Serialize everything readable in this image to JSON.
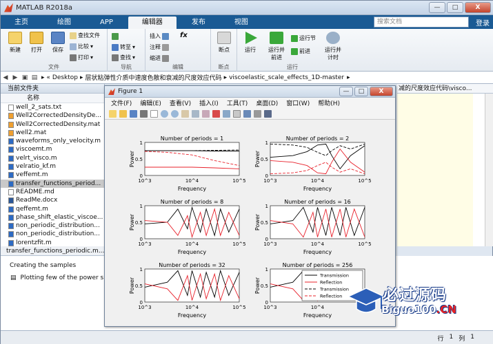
{
  "app": {
    "title": "MATLAB R2018a"
  },
  "window_buttons": {
    "minimize": "—",
    "maximize": "□",
    "close": "X"
  },
  "ribbon_tabs": [
    "主页",
    "绘图",
    "APP",
    "编辑器",
    "发布",
    "视图"
  ],
  "active_tab_index": 3,
  "search": {
    "placeholder": "搜索文档"
  },
  "login_label": "登录",
  "toolstrip": {
    "file_group": {
      "label": "文件",
      "new": "新建",
      "open": "打开",
      "save": "保存",
      "find_files": "查找文件",
      "compare": "比较",
      "print": "打印"
    },
    "nav_group": {
      "label": "导航",
      "goto": "转至",
      "find": "查找"
    },
    "edit_group": {
      "label": "编辑",
      "insert": "插入",
      "comment": "注释",
      "indent": "缩进",
      "fx": "fx"
    },
    "bp_group": {
      "label": "断点",
      "breakpoints": "断点"
    },
    "run_group": {
      "label": "运行",
      "run": "运行",
      "run_advance": "运行并\n前进",
      "run_section": "运行节",
      "advance": "前进",
      "run_time": "运行并\n计时"
    }
  },
  "address": {
    "segments": [
      "Desktop",
      "层状粘弹性介质中速度色散和衰减的尺度效应代码",
      "viscoelastic_scale_effects_1D-master"
    ],
    "editor_tail": "减的尺度效应代码\\visco..."
  },
  "current_folder": {
    "title": "当前文件夹",
    "column": "名称",
    "files": [
      {
        "name": "well_2_sats.txt",
        "type": "txt"
      },
      {
        "name": "Well2CorrectedDensityDe...",
        "type": "mat"
      },
      {
        "name": "Well2CorrectedDensity.mat",
        "type": "mat"
      },
      {
        "name": "well2.mat",
        "type": "mat"
      },
      {
        "name": "waveforms_only_velocity.m",
        "type": "m"
      },
      {
        "name": "viscoemt.m",
        "type": "m"
      },
      {
        "name": "velrt_visco.m",
        "type": "m"
      },
      {
        "name": "velratio_kf.m",
        "type": "m"
      },
      {
        "name": "veffemt.m",
        "type": "m"
      },
      {
        "name": "transfer_functions_period...",
        "type": "m",
        "selected": true
      },
      {
        "name": "README.md",
        "type": "txt"
      },
      {
        "name": "ReadMe.docx",
        "type": "doc"
      },
      {
        "name": "qeffemt.m",
        "type": "m"
      },
      {
        "name": "phase_shift_elastic_viscoe...",
        "type": "m"
      },
      {
        "name": "non_periodic_distribution...",
        "type": "m"
      },
      {
        "name": "non_periodic_distribution...",
        "type": "m"
      },
      {
        "name": "lorentzfit.m",
        "type": "m"
      }
    ]
  },
  "details": {
    "filename": "transfer_functions_periodic.m..."
  },
  "outline": {
    "section1": "Creating the samples",
    "section2": "Plotting few of the power sp"
  },
  "status": {
    "row_label": "行",
    "row": "1",
    "col_label": "列",
    "col": "1"
  },
  "figure": {
    "title": "Figure 1",
    "menu": [
      "文件(F)",
      "编辑(E)",
      "查看(V)",
      "插入(I)",
      "工具(T)",
      "桌面(D)",
      "窗口(W)",
      "帮助(H)"
    ]
  },
  "colors": {
    "tabbar": "#1a5a94",
    "series_black": "#000000",
    "series_red": "#e8202a"
  },
  "chart_data": [
    {
      "type": "line",
      "title": "Number of periods = 1",
      "xlabel": "Frequency",
      "ylabel": "Power",
      "xscale": "log",
      "xlim": [
        1000,
        100000
      ],
      "ylim": [
        0,
        1
      ],
      "yticks": [
        0,
        0.5,
        1
      ],
      "xticks": [
        "10^3",
        "10^4",
        "10^5"
      ],
      "series": [
        {
          "color": "black",
          "dash": false,
          "x": [
            1000,
            3000,
            10000,
            30000,
            100000
          ],
          "y": [
            0.75,
            0.75,
            0.75,
            0.74,
            0.74
          ]
        },
        {
          "color": "red",
          "dash": false,
          "x": [
            1000,
            3000,
            10000,
            30000,
            100000
          ],
          "y": [
            0.25,
            0.25,
            0.25,
            0.23,
            0.2
          ]
        },
        {
          "color": "black",
          "dash": true,
          "x": [
            1000,
            3000,
            10000,
            30000,
            100000
          ],
          "y": [
            0.75,
            0.75,
            0.75,
            0.76,
            0.77
          ]
        },
        {
          "color": "red",
          "dash": true,
          "x": [
            1000,
            3000,
            10000,
            30000,
            100000
          ],
          "y": [
            0.73,
            0.7,
            0.62,
            0.45,
            0.3
          ]
        }
      ]
    },
    {
      "type": "line",
      "title": "Number of periods = 2",
      "xlabel": "Frequency",
      "ylabel": "Power",
      "xscale": "log",
      "xlim": [
        1000,
        100000
      ],
      "ylim": [
        0,
        1
      ],
      "yticks": [
        0,
        0.5,
        1
      ],
      "xticks": [
        "10^3",
        "10^4",
        "10^5"
      ],
      "series": [
        {
          "color": "black",
          "dash": false,
          "x": [
            1000,
            3000,
            6000,
            10000,
            15000,
            20000,
            30000,
            50000,
            100000
          ],
          "y": [
            0.55,
            0.6,
            0.72,
            0.92,
            0.95,
            0.6,
            0.2,
            0.6,
            0.9
          ]
        },
        {
          "color": "red",
          "dash": false,
          "x": [
            1000,
            3000,
            6000,
            10000,
            15000,
            20000,
            30000,
            50000,
            100000
          ],
          "y": [
            0.45,
            0.4,
            0.3,
            0.08,
            0.05,
            0.4,
            0.8,
            0.4,
            0.1
          ]
        },
        {
          "color": "black",
          "dash": true,
          "x": [
            1000,
            3000,
            6000,
            10000,
            15000,
            20000,
            30000,
            50000,
            100000
          ],
          "y": [
            0.95,
            0.92,
            0.85,
            0.7,
            0.6,
            0.75,
            0.9,
            0.8,
            0.95
          ]
        },
        {
          "color": "red",
          "dash": true,
          "x": [
            1000,
            3000,
            6000,
            10000,
            15000,
            20000,
            30000,
            50000,
            100000
          ],
          "y": [
            0.05,
            0.08,
            0.15,
            0.3,
            0.4,
            0.25,
            0.1,
            0.2,
            0.05
          ]
        }
      ]
    },
    {
      "type": "line",
      "title": "Number of periods = 8",
      "xlabel": "Frequency",
      "ylabel": "Power",
      "xscale": "log",
      "xlim": [
        1000,
        100000
      ],
      "ylim": [
        0,
        1
      ],
      "yticks": [
        0,
        0.5,
        1
      ],
      "xticks": [
        "10^3",
        "10^4",
        "10^5"
      ],
      "series": [
        {
          "color": "black",
          "dash": false,
          "x": [
            1000,
            3000,
            5000,
            8000,
            10000,
            15000,
            20000,
            30000,
            40000,
            60000,
            100000
          ],
          "y": [
            0.45,
            0.5,
            0.9,
            0.3,
            0.95,
            0.2,
            0.9,
            0.1,
            0.9,
            0.2,
            0.9
          ]
        },
        {
          "color": "red",
          "dash": false,
          "x": [
            1000,
            3000,
            5000,
            8000,
            10000,
            15000,
            20000,
            30000,
            40000,
            60000,
            100000
          ],
          "y": [
            0.55,
            0.5,
            0.1,
            0.7,
            0.05,
            0.8,
            0.1,
            0.9,
            0.1,
            0.8,
            0.1
          ]
        }
      ]
    },
    {
      "type": "line",
      "title": "Number of periods = 16",
      "xlabel": "Frequency",
      "ylabel": "Power",
      "xscale": "log",
      "xlim": [
        1000,
        100000
      ],
      "ylim": [
        0,
        1
      ],
      "yticks": [
        0,
        0.5,
        1
      ],
      "xticks": [
        "10^3",
        "10^4",
        "10^5"
      ],
      "series": [
        {
          "color": "black",
          "dash": false,
          "x": [
            1000,
            3000,
            5000,
            8000,
            10000,
            15000,
            20000,
            30000,
            40000,
            60000,
            100000
          ],
          "y": [
            0.45,
            0.55,
            0.95,
            0.2,
            0.95,
            0.1,
            0.95,
            0.1,
            0.95,
            0.1,
            0.95
          ]
        },
        {
          "color": "red",
          "dash": false,
          "x": [
            1000,
            3000,
            5000,
            8000,
            10000,
            15000,
            20000,
            30000,
            40000,
            60000,
            100000
          ],
          "y": [
            0.55,
            0.45,
            0.05,
            0.8,
            0.05,
            0.9,
            0.05,
            0.9,
            0.05,
            0.9,
            0.05
          ]
        }
      ]
    },
    {
      "type": "line",
      "title": "Number of periods = 32",
      "xlabel": "Frequency",
      "ylabel": "Power",
      "xscale": "log",
      "xlim": [
        1000,
        100000
      ],
      "ylim": [
        0,
        1
      ],
      "yticks": [
        0,
        0.5,
        1
      ],
      "xticks": [
        "10^3",
        "10^4",
        "10^5"
      ],
      "series": [
        {
          "color": "black",
          "dash": false,
          "x": [
            1000,
            3000,
            5000,
            8000,
            10000,
            15000,
            20000,
            30000,
            40000,
            60000,
            100000
          ],
          "y": [
            0.45,
            0.6,
            0.95,
            0.2,
            0.95,
            0.15,
            0.9,
            0.15,
            0.95,
            0.2,
            0.9
          ]
        },
        {
          "color": "red",
          "dash": false,
          "x": [
            1000,
            3000,
            5000,
            8000,
            10000,
            15000,
            20000,
            30000,
            40000,
            60000,
            100000
          ],
          "y": [
            0.55,
            0.4,
            0.05,
            0.8,
            0.05,
            0.85,
            0.1,
            0.85,
            0.05,
            0.8,
            0.1
          ]
        }
      ]
    },
    {
      "type": "line",
      "title": "Number of periods = 256",
      "xlabel": "Frequency",
      "ylabel": "Power",
      "xscale": "log",
      "xlim": [
        1000,
        100000
      ],
      "ylim": [
        0,
        1
      ],
      "yticks": [
        0,
        0.5,
        1
      ],
      "xticks": [
        "10^3",
        "10^4",
        "10^5"
      ],
      "legend": [
        "Transmission",
        "Reflection",
        "Transmission",
        "Reflection"
      ],
      "series": [
        {
          "color": "black",
          "dash": false,
          "x": [
            1000,
            3000,
            5000,
            8000,
            10000,
            15000,
            20000
          ],
          "y": [
            0.45,
            0.6,
            0.95,
            0.3,
            0.95,
            0.2,
            0.9
          ]
        },
        {
          "color": "red",
          "dash": false,
          "x": [
            1000,
            3000,
            5000,
            8000,
            10000,
            15000,
            20000
          ],
          "y": [
            0.55,
            0.4,
            0.05,
            0.7,
            0.05,
            0.8,
            0.1
          ]
        }
      ]
    }
  ],
  "watermark": {
    "cn": "必过源码",
    "en_a": "Biguo100",
    "en_b": ".CN"
  }
}
